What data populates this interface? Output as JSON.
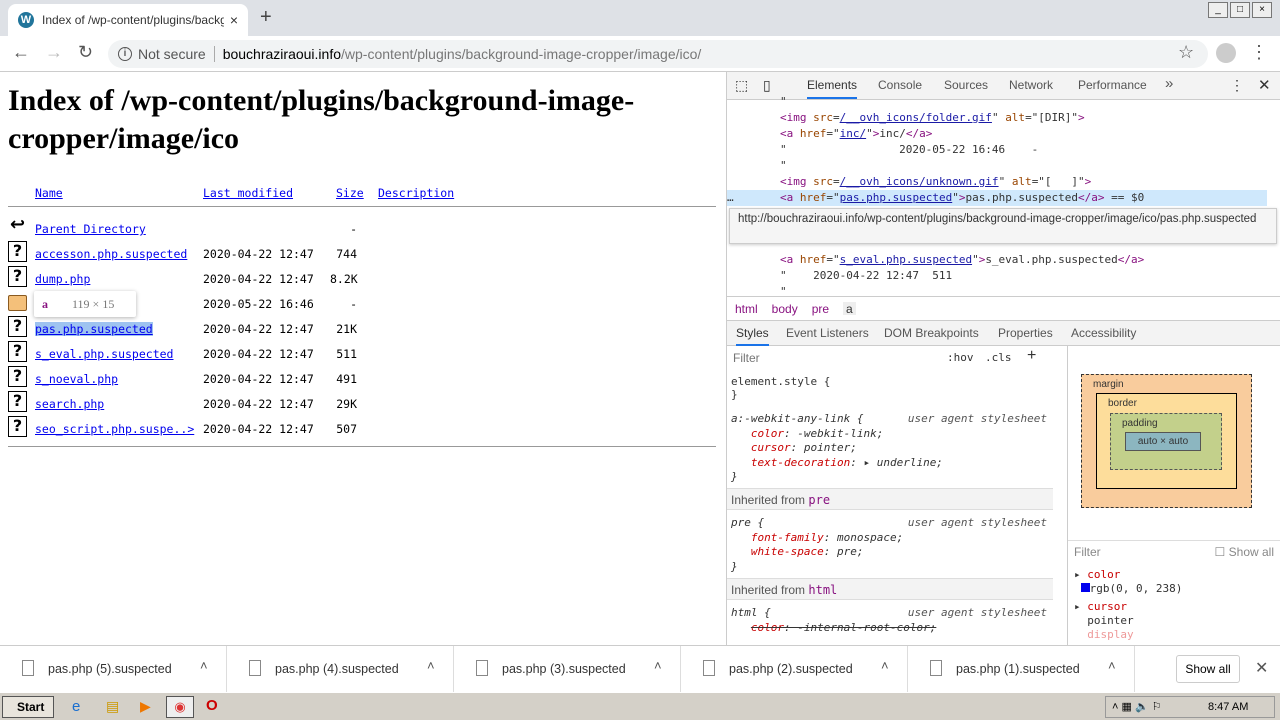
{
  "browser": {
    "tab_title": "Index of /wp-content/plugins/background-image-cropper/image/ico",
    "new_tab": "+",
    "close_tab": "×",
    "security": "Not secure",
    "url_host": "bouchraziraoui.info",
    "url_path": "/wp-content/plugins/background-image-cropper/image/ico/"
  },
  "page": {
    "title": "Index of /wp-content/plugins/background-image-cropper/image/ico",
    "columns": {
      "name": "Name",
      "modified": "Last modified",
      "size": "Size",
      "description": "Description"
    },
    "rows": [
      {
        "icon": "back-icon",
        "name": "Parent Directory",
        "date": "",
        "size": "-"
      },
      {
        "icon": "unknown-file-icon",
        "name": "accesson.php.suspected",
        "date": "2020-04-22 12:47",
        "size": "744"
      },
      {
        "icon": "unknown-file-icon",
        "name": "dump.php",
        "date": "2020-04-22 12:47",
        "size": "8.2K"
      },
      {
        "icon": "folder-icon",
        "name": "inc/",
        "date": "2020-05-22 16:46",
        "size": "-"
      },
      {
        "icon": "unknown-file-icon",
        "name": "pas.php.suspected",
        "date": "2020-04-22 12:47",
        "size": "21K"
      },
      {
        "icon": "unknown-file-icon",
        "name": "s_eval.php.suspected",
        "date": "2020-04-22 12:47",
        "size": "511"
      },
      {
        "icon": "unknown-file-icon",
        "name": "s_noeval.php",
        "date": "2020-04-22 12:47",
        "size": "491"
      },
      {
        "icon": "unknown-file-icon",
        "name": "search.php",
        "date": "2020-04-22 12:47",
        "size": "29K"
      },
      {
        "icon": "unknown-file-icon",
        "name": "seo_script.php.suspe..>",
        "date": "2020-04-22 12:47",
        "size": "507"
      }
    ],
    "hover_tip": {
      "tag": "a",
      "dims": "119 × 15"
    }
  },
  "devtools": {
    "tabs": [
      "Elements",
      "Console",
      "Sources",
      "Network",
      "Performance"
    ],
    "more": "»",
    "url_tooltip": "http://bouchraziraoui.info/wp-content/plugins/background-image-cropper/image/ico/pas.php.suspected",
    "breadcrumbs": [
      "html",
      "body",
      "pre",
      "a"
    ],
    "subtabs": [
      "Styles",
      "Event Listeners",
      "DOM Breakpoints",
      "Properties",
      "Accessibility"
    ],
    "filter_placeholder": "Filter",
    "hov": ":hov",
    "cls": ".cls",
    "computed": {
      "filter": "Filter",
      "show_all": "Show all",
      "color_prop": "color",
      "color_val": "rgb(0, 0, 238)",
      "cursor_prop": "cursor",
      "cursor_val": "pointer",
      "display_prop": "display"
    },
    "boxmodel": {
      "margin": "margin",
      "border": "border",
      "padding": "padding",
      "content": "auto × auto",
      "dash": "–"
    }
  },
  "downloads": {
    "items": [
      "pas.php (5).suspected",
      "pas.php (4).suspected",
      "pas.php (3).suspected",
      "pas.php (2).suspected",
      "pas.php (1).suspected"
    ],
    "show_all": "Show all"
  },
  "taskbar": {
    "start": "Start",
    "clock": "8:47 AM"
  }
}
